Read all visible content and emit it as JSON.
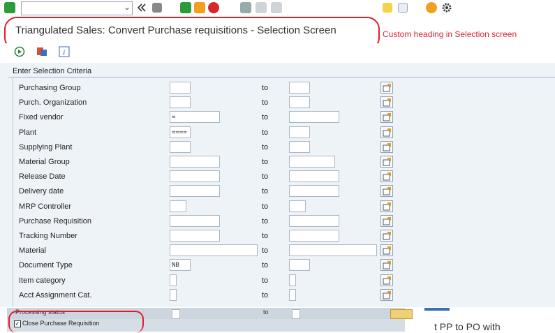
{
  "title": "Triangulated Sales: Convert Purchase requisitions - Selection Screen",
  "annotation": "Custom heading in Selection screen",
  "section_header": "Enter Selection Criteria",
  "to_label": "to",
  "rows": [
    {
      "label": "Purchasing Group",
      "low": ""
    },
    {
      "label": "Purch. Organization",
      "low": ""
    },
    {
      "label": "Fixed vendor",
      "low": "="
    },
    {
      "label": "Plant",
      "low": "===="
    },
    {
      "label": "Supplying Plant",
      "low": ""
    },
    {
      "label": "Material Group",
      "low": ""
    },
    {
      "label": "Release Date",
      "low": ""
    },
    {
      "label": "Delivery date",
      "low": ""
    },
    {
      "label": "MRP Controller",
      "low": ""
    },
    {
      "label": "Purchase Requisition",
      "low": ""
    },
    {
      "label": "Tracking Number",
      "low": ""
    },
    {
      "label": "Material",
      "low": ""
    },
    {
      "label": "Document Type",
      "low": "NB"
    },
    {
      "label": "Item category",
      "low": ""
    },
    {
      "label": "Acct Assignment Cat.",
      "low": ""
    }
  ],
  "bottom": {
    "processing_status": "Processing status",
    "checkbox_label": "Close Purchase Requisition",
    "checkbox_checked": true,
    "right_text": "t PP to PO with"
  },
  "icons": {
    "toolbar": [
      "check-icon",
      "back-icon",
      "save-icon",
      "exit-icon",
      "cancel-icon",
      "print-icon",
      "help-icon",
      "settings-icon"
    ],
    "app_toolbar": [
      "execute-icon",
      "variant-icon",
      "info-icon"
    ]
  },
  "colors": {
    "accent_red": "#e01b2a",
    "bg": "#eef3f8"
  }
}
